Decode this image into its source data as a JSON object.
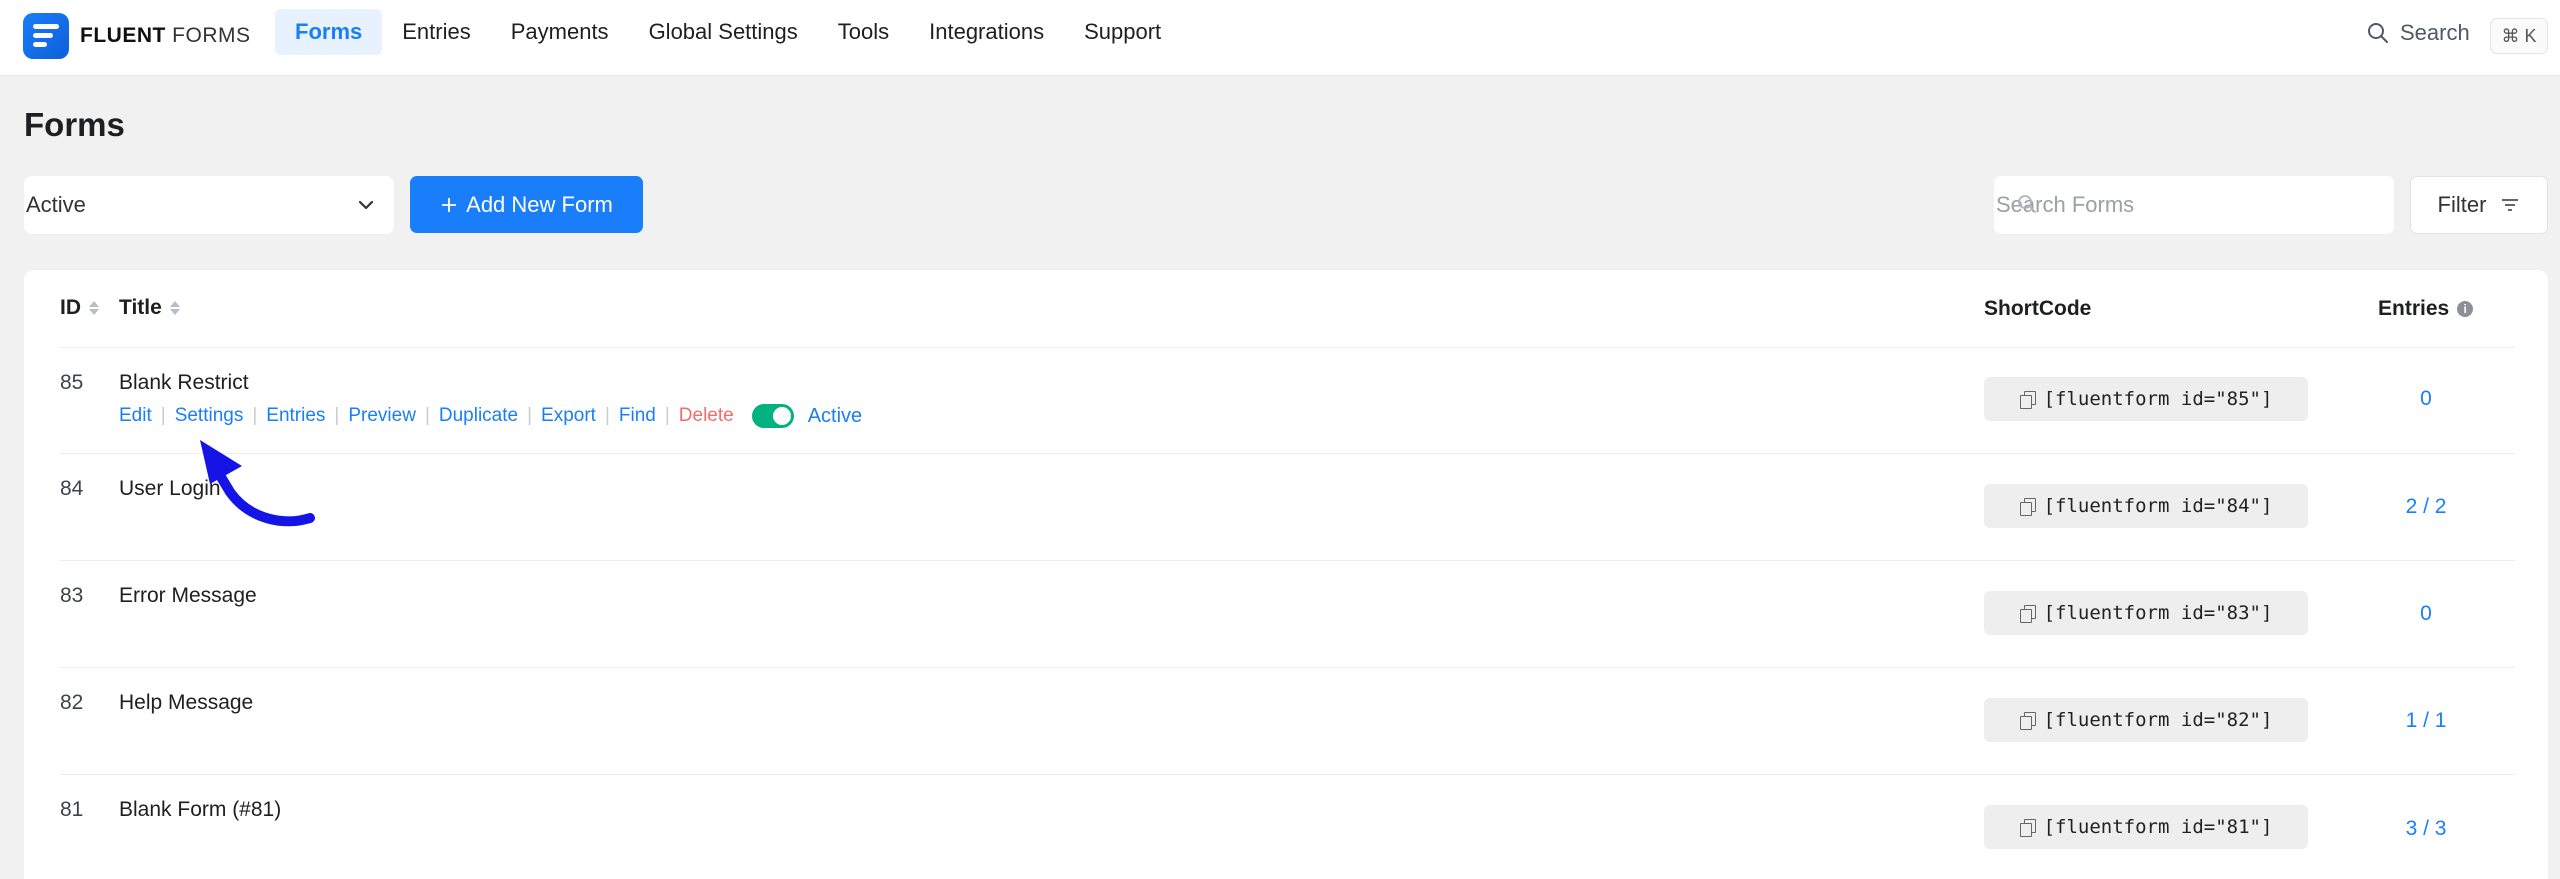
{
  "app": {
    "brand_bold": "FLUENT",
    "brand_light": "FORMS",
    "accent": "#1a7efb"
  },
  "nav": {
    "items": [
      {
        "label": "Forms",
        "active": true
      },
      {
        "label": "Entries"
      },
      {
        "label": "Payments"
      },
      {
        "label": "Global Settings"
      },
      {
        "label": "Tools"
      },
      {
        "label": "Integrations"
      },
      {
        "label": "Support"
      }
    ],
    "search_label": "Search",
    "search_shortcut": "⌘ K"
  },
  "page": {
    "title": "Forms"
  },
  "toolbar": {
    "status_value": "Active",
    "add_label": "Add New Form",
    "search_placeholder": "Search Forms",
    "filter_label": "Filter"
  },
  "table": {
    "headers": {
      "id": "ID",
      "title": "Title",
      "shortcode": "ShortCode",
      "entries": "Entries"
    },
    "row_actions": [
      "Edit",
      "Settings",
      "Entries",
      "Preview",
      "Duplicate",
      "Export",
      "Find",
      "Delete"
    ],
    "status_label": "Active",
    "rows": [
      {
        "id": "85",
        "title": "Blank Restrict",
        "shortcode": "[fluentform id=\"85\"]",
        "entries": "0"
      },
      {
        "id": "84",
        "title": "User Login",
        "shortcode": "[fluentform id=\"84\"]",
        "entries": "2 / 2"
      },
      {
        "id": "83",
        "title": "Error Message",
        "shortcode": "[fluentform id=\"83\"]",
        "entries": "0"
      },
      {
        "id": "82",
        "title": "Help Message",
        "shortcode": "[fluentform id=\"82\"]",
        "entries": "1 / 1"
      },
      {
        "id": "81",
        "title": "Blank Form (#81)",
        "shortcode": "[fluentform id=\"81\"]",
        "entries": "3 / 3"
      }
    ]
  }
}
